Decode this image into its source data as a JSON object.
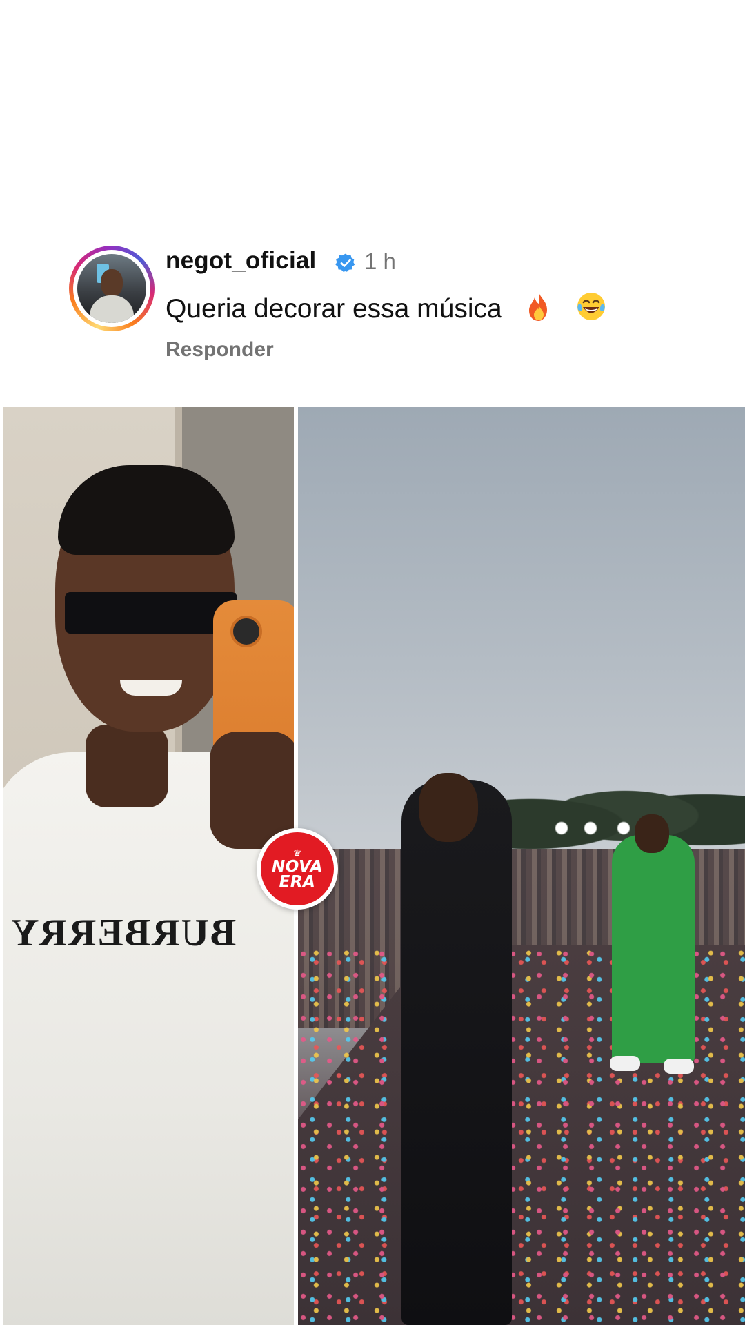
{
  "comment": {
    "username": "negot_oficial",
    "verified": true,
    "time_ago": "1 h",
    "text": "Queria decorar essa música",
    "emojis": [
      "fire-emoji",
      "tears-of-joy-emoji"
    ],
    "reply_label": "Responder"
  },
  "media": {
    "left_panel_shirt_text": "BURBERRY",
    "logo_text_line1": "NOVA",
    "logo_text_line2": "ERA"
  },
  "colors": {
    "verified_blue": "#3897f0",
    "secondary_text": "#737373",
    "logo_red": "#e21b23"
  }
}
